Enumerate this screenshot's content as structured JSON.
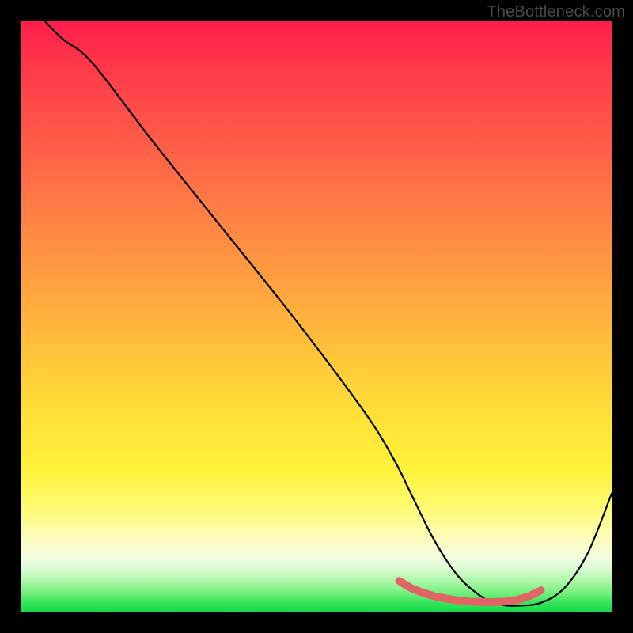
{
  "watermark": "TheBottleneck.com",
  "chart_data": {
    "type": "line",
    "title": "",
    "xlabel": "",
    "ylabel": "",
    "xlim": [
      0,
      100
    ],
    "ylim": [
      0,
      100
    ],
    "series": [
      {
        "name": "bottleneck-curve",
        "style": "black-thin",
        "x": [
          4,
          7,
          12,
          22,
          34,
          46,
          58,
          63,
          66,
          70,
          74,
          78,
          81,
          84,
          88,
          92,
          96,
          100
        ],
        "y": [
          100,
          97,
          93,
          80,
          65,
          50,
          34,
          26,
          20,
          12,
          6,
          2.5,
          1.2,
          1.0,
          1.5,
          4,
          10,
          20
        ]
      },
      {
        "name": "optimal-zone",
        "style": "red-thick-dotted",
        "x": [
          64,
          66,
          68,
          70,
          72,
          74,
          76,
          78,
          80,
          82,
          84,
          86,
          88
        ],
        "y": [
          5.2,
          4.0,
          3.2,
          2.6,
          2.2,
          1.9,
          1.7,
          1.6,
          1.6,
          1.7,
          2.0,
          2.6,
          3.6
        ]
      }
    ],
    "gradient_stops": [
      {
        "pos": 0.0,
        "color": "#ff1e4c"
      },
      {
        "pos": 0.22,
        "color": "#ff6048"
      },
      {
        "pos": 0.46,
        "color": "#ffa63f"
      },
      {
        "pos": 0.68,
        "color": "#ffe337"
      },
      {
        "pos": 0.88,
        "color": "#fdfcc2"
      },
      {
        "pos": 0.95,
        "color": "#a8f7a4"
      },
      {
        "pos": 1.0,
        "color": "#14d94a"
      }
    ]
  }
}
